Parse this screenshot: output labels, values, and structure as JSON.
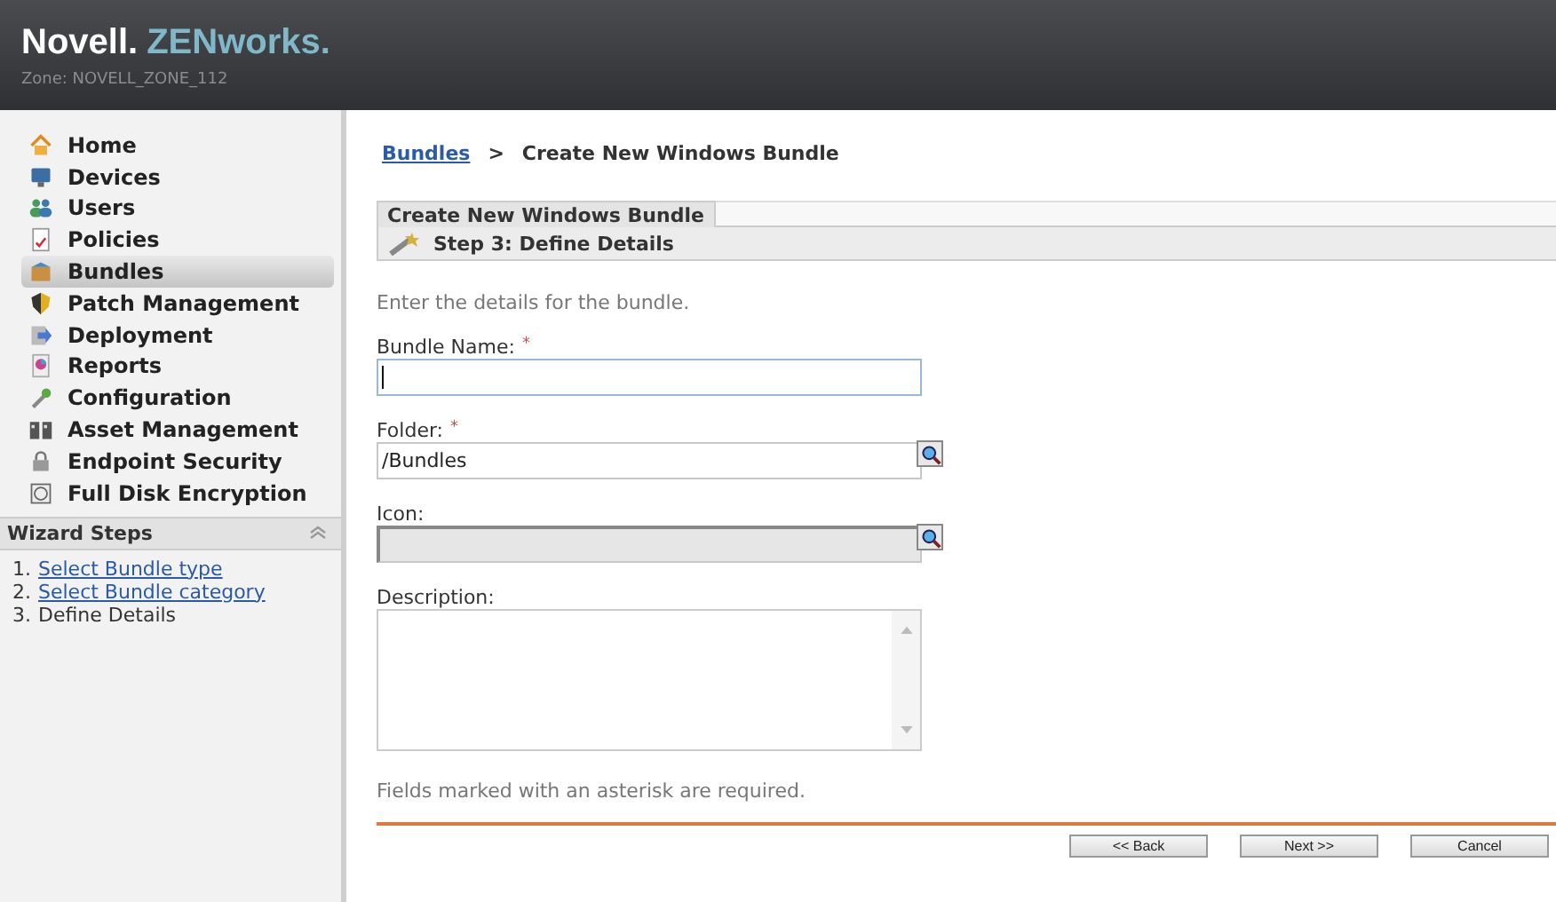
{
  "header": {
    "brand": "Novell.",
    "product": "ZENworks.",
    "zone": "Zone: NOVELL_ZONE_112"
  },
  "sidebar": {
    "items": [
      {
        "label": "Home",
        "selected": false
      },
      {
        "label": "Devices",
        "selected": false
      },
      {
        "label": "Users",
        "selected": false
      },
      {
        "label": "Policies",
        "selected": false
      },
      {
        "label": "Bundles",
        "selected": true
      },
      {
        "label": "Patch Management",
        "selected": false
      },
      {
        "label": "Deployment",
        "selected": false
      },
      {
        "label": "Reports",
        "selected": false
      },
      {
        "label": "Configuration",
        "selected": false
      },
      {
        "label": "Asset Management",
        "selected": false
      },
      {
        "label": "Endpoint Security",
        "selected": false
      },
      {
        "label": "Full Disk Encryption",
        "selected": false
      }
    ]
  },
  "wizard_steps": {
    "title": "Wizard Steps",
    "expanded": true,
    "steps": [
      {
        "number": "1.",
        "label": "Select Bundle type",
        "kind": "link"
      },
      {
        "number": "2.",
        "label": "Select Bundle category",
        "kind": "link"
      },
      {
        "number": "3.",
        "label": "Define Details",
        "kind": "current"
      }
    ]
  },
  "breadcrumb": {
    "items": [
      {
        "label": "Bundles",
        "kind": "link"
      },
      {
        "label": ">",
        "kind": "separator"
      },
      {
        "label": "Create New Windows Bundle",
        "kind": "current"
      }
    ]
  },
  "panel": {
    "tab": "Create New Windows Bundle",
    "step": "Step 3: Define Details"
  },
  "intro": "Enter the details for the bundle.",
  "fields": [
    {
      "label": "Bundle Name:",
      "required_mark": "*",
      "kind": "text",
      "focused": true,
      "disabled": false,
      "browse": false
    },
    {
      "label": "Folder:",
      "required_mark": "*",
      "kind": "text",
      "value": "/Bundles",
      "focused": false,
      "disabled": false,
      "browse": true
    },
    {
      "label": "Icon:",
      "kind": "text",
      "focused": false,
      "disabled": true,
      "browse": true
    },
    {
      "label": "Description:",
      "kind": "textarea",
      "focused": false,
      "disabled": false,
      "browse": false
    }
  ],
  "note": "Fields marked with an asterisk are required.",
  "buttons": [
    "<< Back",
    "Next >>",
    "Cancel"
  ]
}
